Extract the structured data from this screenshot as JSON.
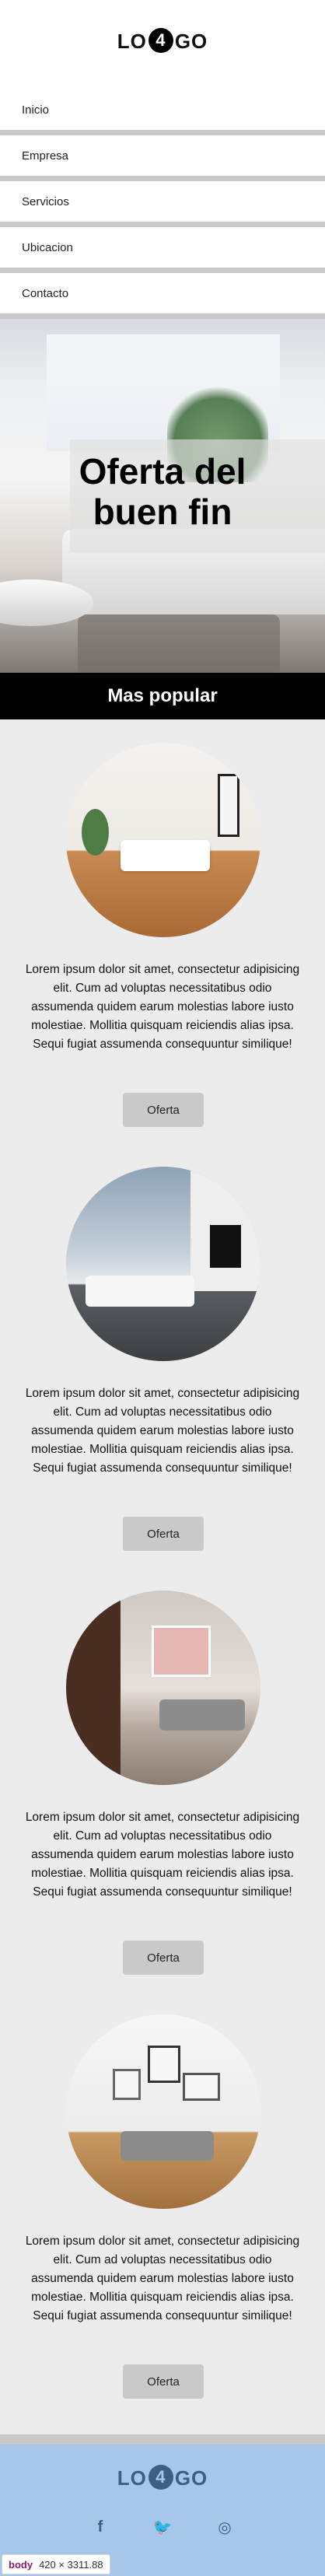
{
  "header": {
    "logo_left": "LO",
    "logo_mid": "4",
    "logo_right": "GO"
  },
  "nav": {
    "items": [
      "Inicio",
      "Empresa",
      "Servicios",
      "Ubicacion",
      "Contacto"
    ]
  },
  "hero": {
    "title_line1": "Oferta del",
    "title_line2": "buen fin"
  },
  "section": {
    "title": "Mas popular"
  },
  "cards": [
    {
      "text": "Lorem ipsum dolor sit amet, consectetur adipisicing elit. Cum ad voluptas necessitatibus odio assumenda quidem earum molestias labore iusto molestiae. Mollitia quisquam reiciendis alias ipsa. Sequi fugiat assumenda consequuntur similique!",
      "button": "Oferta"
    },
    {
      "text": "Lorem ipsum dolor sit amet, consectetur adipisicing elit. Cum ad voluptas necessitatibus odio assumenda quidem earum molestias labore iusto molestiae. Mollitia quisquam reiciendis alias ipsa. Sequi fugiat assumenda consequuntur similique!",
      "button": "Oferta"
    },
    {
      "text": "Lorem ipsum dolor sit amet, consectetur adipisicing elit. Cum ad voluptas necessitatibus odio assumenda quidem earum molestias labore iusto molestiae. Mollitia quisquam reiciendis alias ipsa. Sequi fugiat assumenda consequuntur similique!",
      "button": "Oferta"
    },
    {
      "text": "Lorem ipsum dolor sit amet, consectetur adipisicing elit. Cum ad voluptas necessitatibus odio assumenda quidem earum molestias labore iusto molestiae. Mollitia quisquam reiciendis alias ipsa. Sequi fugiat assumenda consequuntur similique!",
      "button": "Oferta"
    }
  ],
  "footer": {
    "logo_left": "LO",
    "logo_mid": "4",
    "logo_right": "GO",
    "social": [
      {
        "icon": "facebook-icon",
        "glyph": "f"
      },
      {
        "icon": "twitter-icon",
        "glyph": "🐦"
      },
      {
        "icon": "instagram-icon",
        "glyph": "◎"
      }
    ]
  },
  "devtools_tooltip": {
    "tag": "body",
    "size": "420 × 3311.88"
  },
  "colors": {
    "nav_divider": "#c9c9c9",
    "popular_bar": "#000000",
    "content_bg": "#ececec",
    "button_bg": "#c9c9c9",
    "footer_bg": "#a6c6ea",
    "footer_text": "#3f5f82"
  }
}
